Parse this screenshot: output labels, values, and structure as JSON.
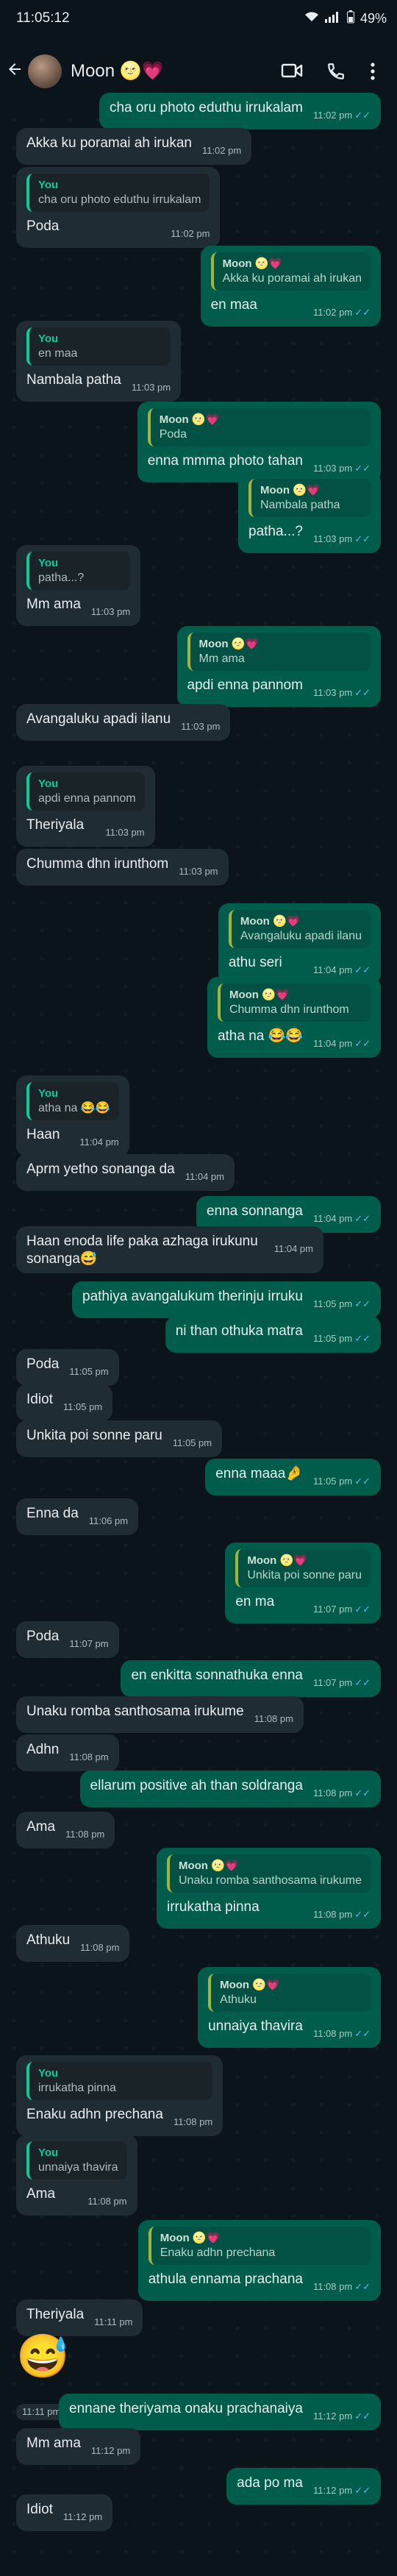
{
  "status_bar": {
    "time": "11:05:12",
    "battery": "49%"
  },
  "header": {
    "contact_name": "Moon 🌝💗"
  },
  "quote_name": "Moon 🌝💗",
  "you_label": "You",
  "messages": [
    {
      "d": "out",
      "text": "cha oru photo eduthu irrukalam",
      "time": "11:02 pm",
      "tick": true
    },
    {
      "d": "in",
      "text": "Akka ku poramai ah irukan",
      "time": "11:02 pm"
    },
    {
      "d": "in",
      "text": "Poda",
      "time": "11:02 pm",
      "q_name": "You",
      "q_text": "cha oru photo eduthu irrukalam"
    },
    {
      "d": "out",
      "text": "en maa",
      "time": "11:02 pm",
      "tick": true,
      "q_name": "Moon 🌝💗",
      "q_text": "Akka ku poramai ah irukan"
    },
    {
      "d": "in",
      "text": "Nambala patha",
      "time": "11:03 pm",
      "q_name": "You",
      "q_text": "en maa"
    },
    {
      "d": "out",
      "text": "enna mmma photo tahan",
      "time": "11:03 pm",
      "tick": true,
      "q_name": "Moon 🌝💗",
      "q_text": "Poda"
    },
    {
      "d": "out",
      "text": "patha...?",
      "time": "11:03 pm",
      "tick": true,
      "q_name": "Moon 🌝💗",
      "q_text": "Nambala patha"
    },
    {
      "d": "in",
      "text": "Mm ama",
      "time": "11:03 pm",
      "q_name": "You",
      "q_text": "patha...?"
    },
    {
      "d": "out",
      "text": "apdi enna pannom",
      "time": "11:03 pm",
      "tick": true,
      "q_name": "Moon 🌝💗",
      "q_text": "Mm ama"
    },
    {
      "d": "in",
      "text": "Avangaluku apadi ilanu",
      "time": "11:03 pm"
    },
    {
      "d": "in",
      "text": "Theriyala",
      "time": "11:03 pm",
      "q_name": "You",
      "q_text": "apdi enna pannom"
    },
    {
      "d": "in",
      "text": "Chumma dhn irunthom",
      "time": "11:03 pm"
    },
    {
      "d": "out",
      "text": "athu seri",
      "time": "11:04 pm",
      "tick": true,
      "q_name": "Moon 🌝💗",
      "q_text": "Avangaluku apadi ilanu"
    },
    {
      "d": "out",
      "text": "atha na 😂😂",
      "time": "11:04 pm",
      "tick": true,
      "q_name": "Moon 🌝💗",
      "q_text": "Chumma dhn irunthom"
    },
    {
      "d": "in",
      "text": "Haan",
      "time": "11:04 pm",
      "q_name": "You",
      "q_text": "atha na 😂😂"
    },
    {
      "d": "in",
      "text": "Aprm yetho sonanga da",
      "time": "11:04 pm"
    },
    {
      "d": "out",
      "text": "enna sonnanga",
      "time": "11:04 pm",
      "tick": true
    },
    {
      "d": "in",
      "text": "Haan enoda life paka azhaga irukunu sonanga😅",
      "time": "11:04 pm",
      "wrap": true
    },
    {
      "d": "out",
      "text": "pathiya avangalukum therinju irruku",
      "time": "11:05 pm",
      "tick": true
    },
    {
      "d": "out",
      "text": "ni than othuka matra",
      "time": "11:05 pm",
      "tick": true
    },
    {
      "d": "in",
      "text": "Poda",
      "time": "11:05 pm"
    },
    {
      "d": "in",
      "text": "Idiot",
      "time": "11:05 pm"
    },
    {
      "d": "in",
      "text": "Unkita poi sonne paru",
      "time": "11:05 pm"
    },
    {
      "d": "out",
      "text": "enna maaa🤌",
      "time": "11:05 pm",
      "tick": true
    },
    {
      "d": "in",
      "text": "Enna da",
      "time": "11:06 pm"
    },
    {
      "d": "out",
      "text": "en ma",
      "time": "11:07 pm",
      "tick": true,
      "q_name": "Moon 🌝💗",
      "q_text": "Unkita poi sonne paru"
    },
    {
      "d": "in",
      "text": "Poda",
      "time": "11:07 pm"
    },
    {
      "d": "out",
      "text": "en enkitta sonnathuka enna",
      "time": "11:07 pm",
      "tick": true
    },
    {
      "d": "in",
      "text": "Unaku romba santhosama irukume",
      "time": "11:08 pm"
    },
    {
      "d": "in",
      "text": "Adhn",
      "time": "11:08 pm"
    },
    {
      "d": "out",
      "text": "ellarum positive ah than soldranga",
      "time": "11:08 pm",
      "tick": true
    },
    {
      "d": "in",
      "text": "Ama",
      "time": "11:08 pm"
    },
    {
      "d": "out",
      "text": "irrukatha pinna",
      "time": "11:08 pm",
      "tick": true,
      "q_name": "Moon 🌝💗",
      "q_text": "Unaku romba santhosama irukume"
    },
    {
      "d": "in",
      "text": "Athuku",
      "time": "11:08 pm"
    },
    {
      "d": "out",
      "text": "unnaiya thavira",
      "time": "11:08 pm",
      "tick": true,
      "q_name": "Moon 🌝💗",
      "q_text": "Athuku"
    },
    {
      "d": "in",
      "text": "Enaku adhn prechana",
      "time": "11:08 pm",
      "q_name": "You",
      "q_text": "irrukatha pinna"
    },
    {
      "d": "in",
      "text": "Ama",
      "time": "11:08 pm",
      "q_name": "You",
      "q_text": "unnaiya thavira"
    },
    {
      "d": "out",
      "text": "athula ennama prachana",
      "time": "11:08 pm",
      "tick": true,
      "q_name": "Moon 🌝💗",
      "q_text": "Enaku adhn prechana"
    },
    {
      "d": "in",
      "text": "Theriyala",
      "time": "11:11 pm"
    },
    {
      "d": "in",
      "text": "😅",
      "time": "11:11 pm",
      "emoji": true
    },
    {
      "d": "out",
      "text": "ennane theriyama onaku prachanaiya",
      "time": "11:12 pm",
      "tick": true
    },
    {
      "d": "in",
      "text": "Mm ama",
      "time": "11:12 pm"
    },
    {
      "d": "out",
      "text": "ada po ma",
      "time": "11:12 pm",
      "tick": true
    },
    {
      "d": "in",
      "text": "Idiot",
      "time": "11:12 pm"
    }
  ]
}
